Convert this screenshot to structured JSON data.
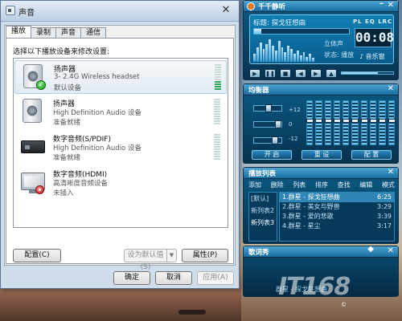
{
  "dialog": {
    "title": "声音",
    "tabs": [
      "播放",
      "录制",
      "声音",
      "通信"
    ],
    "instruction": "选择以下播放设备来修改设置:",
    "devices": [
      {
        "name": "扬声器",
        "sub": "3- 2.4G Wireless headset",
        "status": "默认设备",
        "icon": "speaker-icon",
        "badge": "check-icon",
        "level": 0.35
      },
      {
        "name": "扬声器",
        "sub": "High Definition Audio 设备",
        "status": "准备就绪",
        "icon": "speaker-icon",
        "badge": "",
        "level": 0
      },
      {
        "name": "数字音频(S/PDIF)",
        "sub": "High Definition Audio 设备",
        "status": "准备就绪",
        "icon": "spdif-device-icon",
        "badge": "",
        "level": 0
      },
      {
        "name": "数字音频(HDMI)",
        "sub": "高清晰度音频设备",
        "status": "未插入",
        "icon": "hdmi-monitor-icon",
        "badge": "unplugged-icon",
        "level": 0
      }
    ],
    "buttons": {
      "configure": "配置(C)",
      "set_default": "设为默认值(S)",
      "properties": "属性(P)",
      "ok": "确定",
      "cancel": "取消",
      "apply": "应用(A)"
    }
  },
  "player": {
    "app_title": "千千静听",
    "song": "标题: 探戈狂想曲",
    "stereo": "立体声",
    "state": "状态: 播放",
    "flags": "PL EQ LRC",
    "time": "00:08",
    "show": "♪ 音乐窗",
    "progress": 0.08,
    "volume": 0.7
  },
  "equalizer": {
    "title": "均衡器",
    "scale_top": "+12",
    "scale_mid": "0",
    "scale_bottom": "-12",
    "buttons": [
      "开 启",
      "重 设",
      "配 置"
    ]
  },
  "playlist": {
    "title": "播放列表",
    "menu": [
      "添加",
      "删除",
      "列表",
      "排序",
      "查找",
      "编辑",
      "模式"
    ],
    "groups": [
      "[默认]",
      "新列表2",
      "新列表3"
    ],
    "tracks": [
      {
        "title": "1.群星 - 探戈狂想曲",
        "duration": "6:25"
      },
      {
        "title": "2.群星 - 美女与野兽",
        "duration": "3:29"
      },
      {
        "title": "3.群星 - 爱的悲歌",
        "duration": "3:39"
      },
      {
        "title": "4.群星 - 星尘",
        "duration": "3:17"
      }
    ]
  },
  "lyrics": {
    "title": "歌词秀",
    "text": "群星 - 探戈狂想曲"
  },
  "watermark": {
    "logo": "IT168",
    "copyright": "©"
  },
  "colors": {
    "accent": "#0b5c86",
    "meter_green": "#2ea55a"
  }
}
